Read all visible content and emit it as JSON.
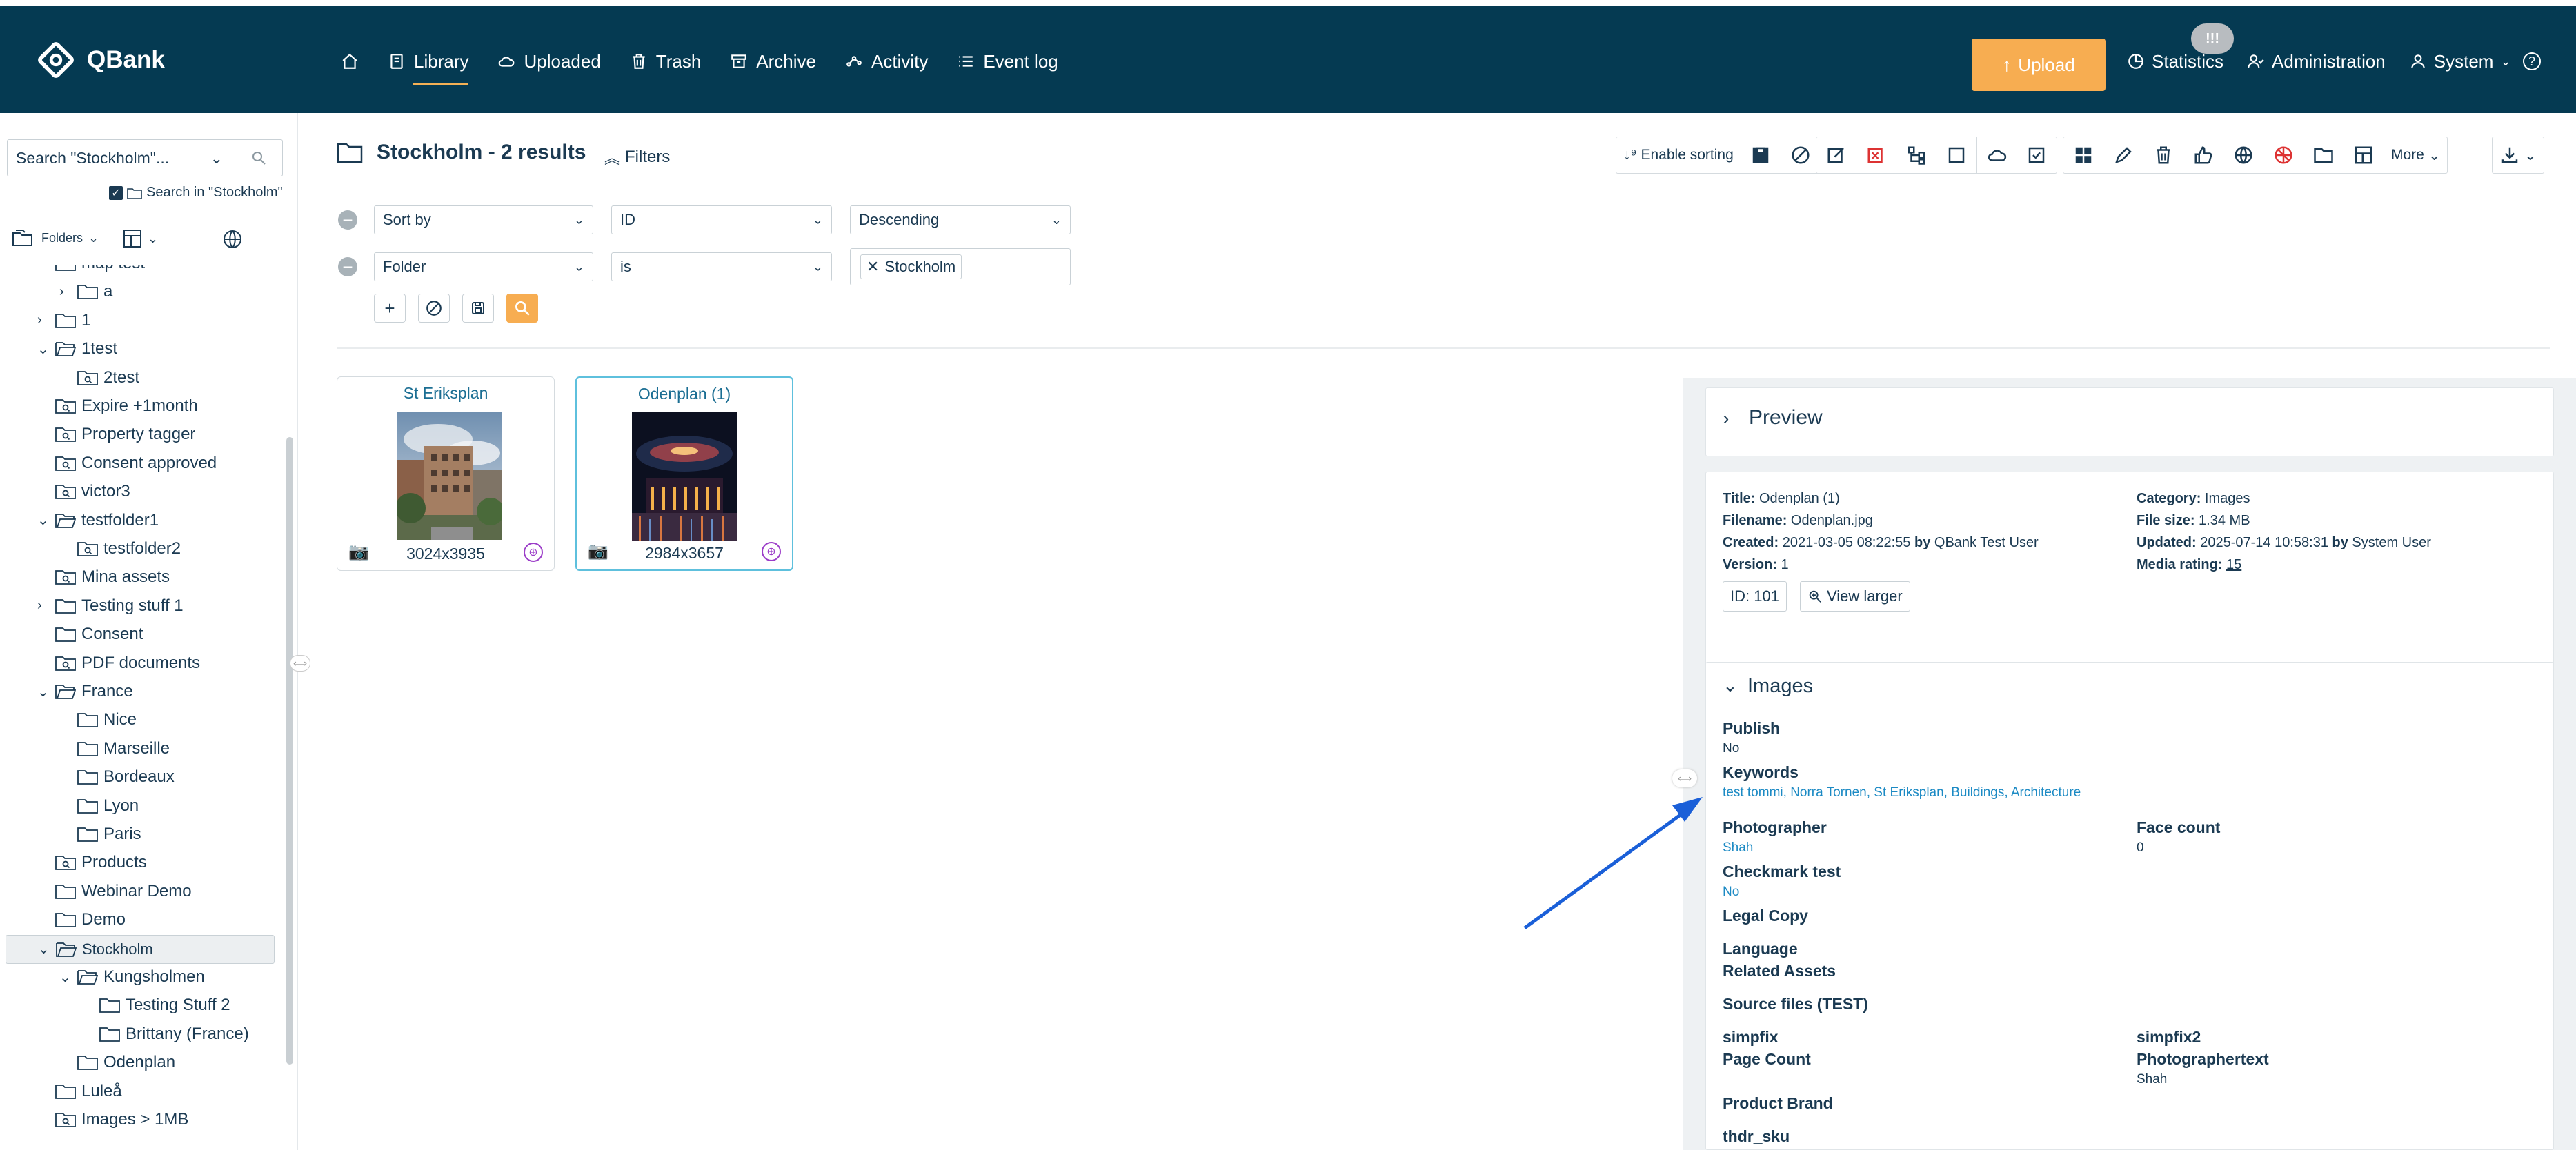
{
  "app": {
    "name": "QBank"
  },
  "nav": {
    "home": "",
    "items": [
      {
        "label": "Library",
        "icon": "library-icon"
      },
      {
        "label": "Uploaded",
        "icon": "cloud-icon"
      },
      {
        "label": "Trash",
        "icon": "trash-icon"
      },
      {
        "label": "Archive",
        "icon": "archive-icon"
      },
      {
        "label": "Activity",
        "icon": "activity-icon"
      },
      {
        "label": "Event log",
        "icon": "list-icon"
      }
    ],
    "active": "Library",
    "upload_label": "Upload",
    "statistics": "Statistics",
    "statistics_badge": "!!!",
    "administration": "Administration",
    "user": "System",
    "help": "?"
  },
  "sidebar": {
    "search_value": "Search \"Stockholm\"...",
    "search_in": "Search in \"Stockholm\"",
    "folders_label": "Folders",
    "tree": [
      {
        "label": "map test",
        "indent": 1,
        "chev": "",
        "icon": "folder"
      },
      {
        "label": "a",
        "indent": 2,
        "chev": ">",
        "icon": "folder"
      },
      {
        "label": "1",
        "indent": 1,
        "chev": ">",
        "icon": "folder"
      },
      {
        "label": "1test",
        "indent": 1,
        "chev": "v",
        "icon": "folder-open"
      },
      {
        "label": "2test",
        "indent": 2,
        "chev": "",
        "icon": "folder-search"
      },
      {
        "label": "Expire +1month",
        "indent": 1,
        "chev": "",
        "icon": "folder-search"
      },
      {
        "label": "Property tagger",
        "indent": 1,
        "chev": "",
        "icon": "folder-search"
      },
      {
        "label": "Consent approved",
        "indent": 1,
        "chev": "",
        "icon": "folder-search"
      },
      {
        "label": "victor3",
        "indent": 1,
        "chev": "",
        "icon": "folder-search"
      },
      {
        "label": "testfolder1",
        "indent": 1,
        "chev": "v",
        "icon": "folder-open"
      },
      {
        "label": "testfolder2",
        "indent": 2,
        "chev": "",
        "icon": "folder-search"
      },
      {
        "label": "Mina assets",
        "indent": 1,
        "chev": "",
        "icon": "folder-search"
      },
      {
        "label": "Testing stuff 1",
        "indent": 1,
        "chev": ">",
        "icon": "folder"
      },
      {
        "label": "Consent",
        "indent": 1,
        "chev": "",
        "icon": "folder"
      },
      {
        "label": "PDF documents",
        "indent": 1,
        "chev": "",
        "icon": "folder-search"
      },
      {
        "label": "France",
        "indent": 1,
        "chev": "v",
        "icon": "folder-open"
      },
      {
        "label": "Nice",
        "indent": 2,
        "chev": "",
        "icon": "folder"
      },
      {
        "label": "Marseille",
        "indent": 2,
        "chev": "",
        "icon": "folder"
      },
      {
        "label": "Bordeaux",
        "indent": 2,
        "chev": "",
        "icon": "folder"
      },
      {
        "label": "Lyon",
        "indent": 2,
        "chev": "",
        "icon": "folder"
      },
      {
        "label": "Paris",
        "indent": 2,
        "chev": "",
        "icon": "folder"
      },
      {
        "label": "Products",
        "indent": 1,
        "chev": "",
        "icon": "folder-search"
      },
      {
        "label": "Webinar Demo",
        "indent": 1,
        "chev": "",
        "icon": "folder"
      },
      {
        "label": "Demo",
        "indent": 1,
        "chev": "",
        "icon": "folder"
      },
      {
        "label": "Stockholm",
        "indent": 1,
        "chev": "v",
        "icon": "folder-open",
        "selected": true
      },
      {
        "label": "Kungsholmen",
        "indent": 2,
        "chev": "v",
        "icon": "folder-open"
      },
      {
        "label": "Testing Stuff 2",
        "indent": 3,
        "chev": "",
        "icon": "folder"
      },
      {
        "label": "Brittany (France)",
        "indent": 3,
        "chev": "",
        "icon": "folder"
      },
      {
        "label": "Odenplan",
        "indent": 2,
        "chev": "",
        "icon": "folder"
      },
      {
        "label": "Luleå",
        "indent": 1,
        "chev": "",
        "icon": "folder"
      },
      {
        "label": "Images > 1MB",
        "indent": 1,
        "chev": "",
        "icon": "folder-search"
      }
    ]
  },
  "main": {
    "title": "Stockholm - 2 results",
    "filters_label": "Filters",
    "toolbar": {
      "enable_sorting": "Enable sorting",
      "more": "More"
    },
    "filter_rows": [
      {
        "field": "Sort by",
        "op": "ID",
        "value": "Descending"
      },
      {
        "field": "Folder",
        "op": "is",
        "tag": "Stockholm"
      }
    ],
    "results": [
      {
        "title": "St Eriksplan",
        "dims": "3024x3935"
      },
      {
        "title": "Odenplan (1)",
        "dims": "2984x3657"
      }
    ]
  },
  "detail": {
    "preview_label": "Preview",
    "title_label": "Title:",
    "title": "Odenplan (1)",
    "filename_label": "Filename:",
    "filename": "Odenplan.jpg",
    "created_label": "Created:",
    "created": "2021-03-05 08:22:55",
    "created_by_label": "by",
    "created_by": "QBank Test User",
    "version_label": "Version:",
    "version": "1",
    "category_label": "Category:",
    "category": "Images",
    "filesize_label": "File size:",
    "filesize": "1.34 MB",
    "updated_label": "Updated:",
    "updated": "2025-07-14 10:58:31",
    "updated_by_label": "by",
    "updated_by": "System User",
    "rating_label": "Media rating:",
    "rating": "15",
    "id_button": "ID: 101",
    "view_larger": "View larger",
    "images_section": "Images",
    "fields": {
      "publish_label": "Publish",
      "publish": "No",
      "keywords_label": "Keywords",
      "keywords": [
        "test tommi",
        "Norra Tornen",
        "St Eriksplan",
        "Buildings",
        "Architecture"
      ],
      "photographer_label": "Photographer",
      "photographer": "Shah",
      "face_count_label": "Face count",
      "face_count": "0",
      "checkmark_label": "Checkmark test",
      "checkmark": "No",
      "legal_copy_label": "Legal Copy",
      "language_label": "Language",
      "related_label": "Related Assets",
      "source_files_label": "Source files (TEST)",
      "simpfix_label": "simpfix",
      "simpfix2_label": "simpfix2",
      "page_count_label": "Page Count",
      "photographertext_label": "Photographertext",
      "photographertext": "Shah",
      "brand_label": "Product Brand",
      "sku_label": "thdr_sku"
    }
  },
  "colors": {
    "header": "#053a52",
    "accent": "#f7ad51",
    "link": "#1c8ac4",
    "annotation_arrow": "#1a5fd8"
  }
}
